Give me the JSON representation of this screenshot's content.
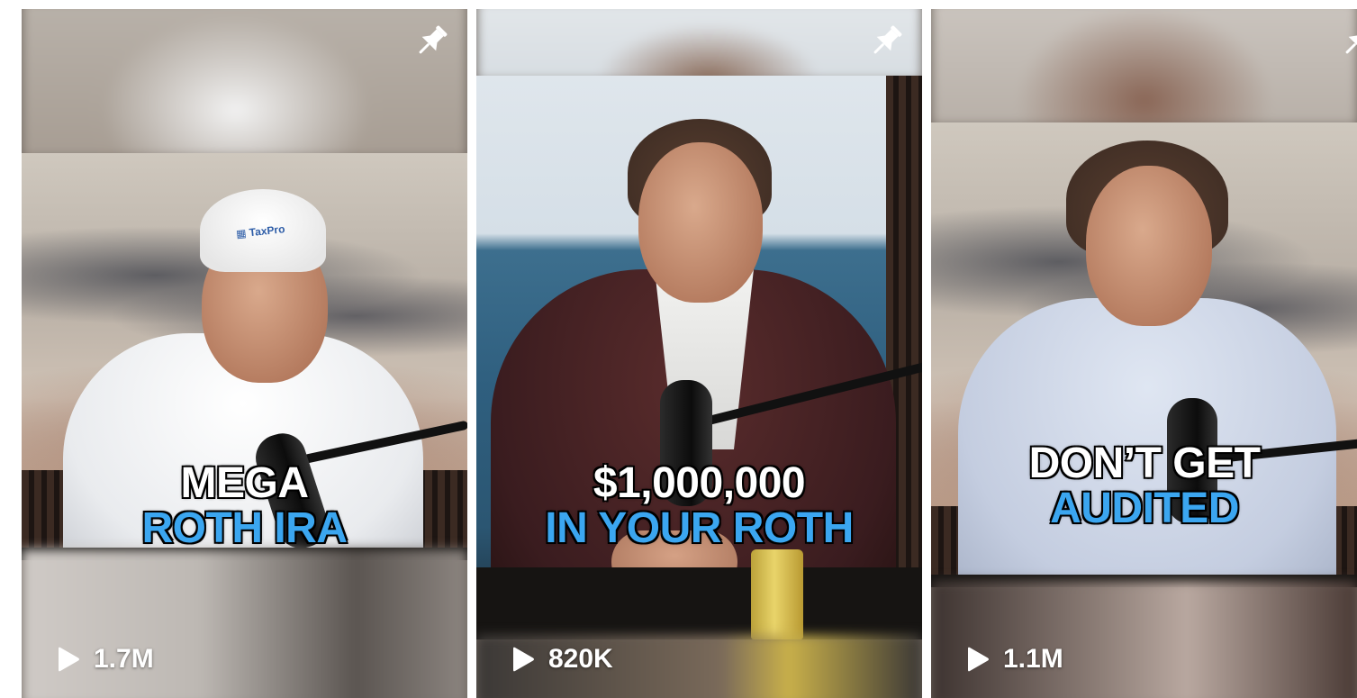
{
  "reels": [
    {
      "caption_line1": "MEGA",
      "caption_line2": "ROTH IRA",
      "views": "1.7M",
      "pin_icon": "pushpin-icon",
      "play_icon": "play-icon"
    },
    {
      "caption_line1": "$1,000,000",
      "caption_line2": "IN YOUR ROTH",
      "views": "820K",
      "pin_icon": "pushpin-icon",
      "play_icon": "play-icon"
    },
    {
      "caption_line1": "DON’T GET",
      "caption_line2": "AUDITED",
      "views": "1.1M",
      "pin_icon": "pushpin-icon",
      "play_icon": "play-icon"
    }
  ],
  "colors": {
    "caption_primary": "#ffffff",
    "caption_accent": "#3ba6f0",
    "caption_outline": "#000000"
  }
}
